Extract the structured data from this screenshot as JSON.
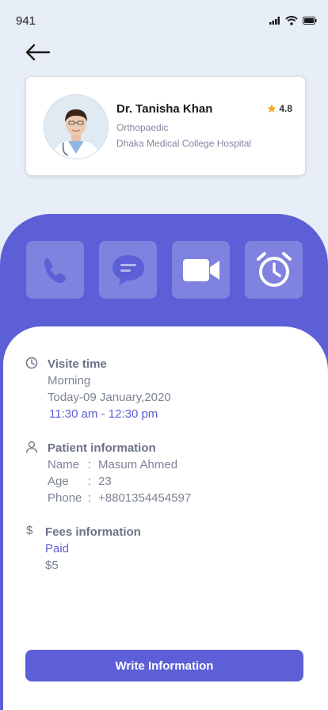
{
  "status_bar": {
    "time": "941"
  },
  "doctor": {
    "name": "Dr. Tanisha Khan",
    "specialty": "Orthopaedic",
    "hospital": "Dhaka Medical College Hospital",
    "rating": "4.8"
  },
  "actions": [
    {
      "icon": "phone-icon"
    },
    {
      "icon": "chat-icon"
    },
    {
      "icon": "video-icon"
    },
    {
      "icon": "alarm-icon"
    }
  ],
  "visit": {
    "title": "Visite time",
    "period": "Morning",
    "date": "Today-09 January,2020",
    "time": "11:30 am - 12:30 pm"
  },
  "patient": {
    "title": "Patient information",
    "name_label": "Name",
    "name_value": "Masum Ahmed",
    "age_label": "Age",
    "age_value": "23",
    "phone_label": "Phone",
    "phone_value": "+8801354454597",
    "sep": ":"
  },
  "fees": {
    "title": "Fees information",
    "status": "Paid",
    "amount": "$5",
    "icon_text": "$"
  },
  "button": {
    "label": "Write Information"
  },
  "colors": {
    "accent": "#5c5fd6",
    "background": "#e8eef8",
    "star": "#f5a623"
  }
}
